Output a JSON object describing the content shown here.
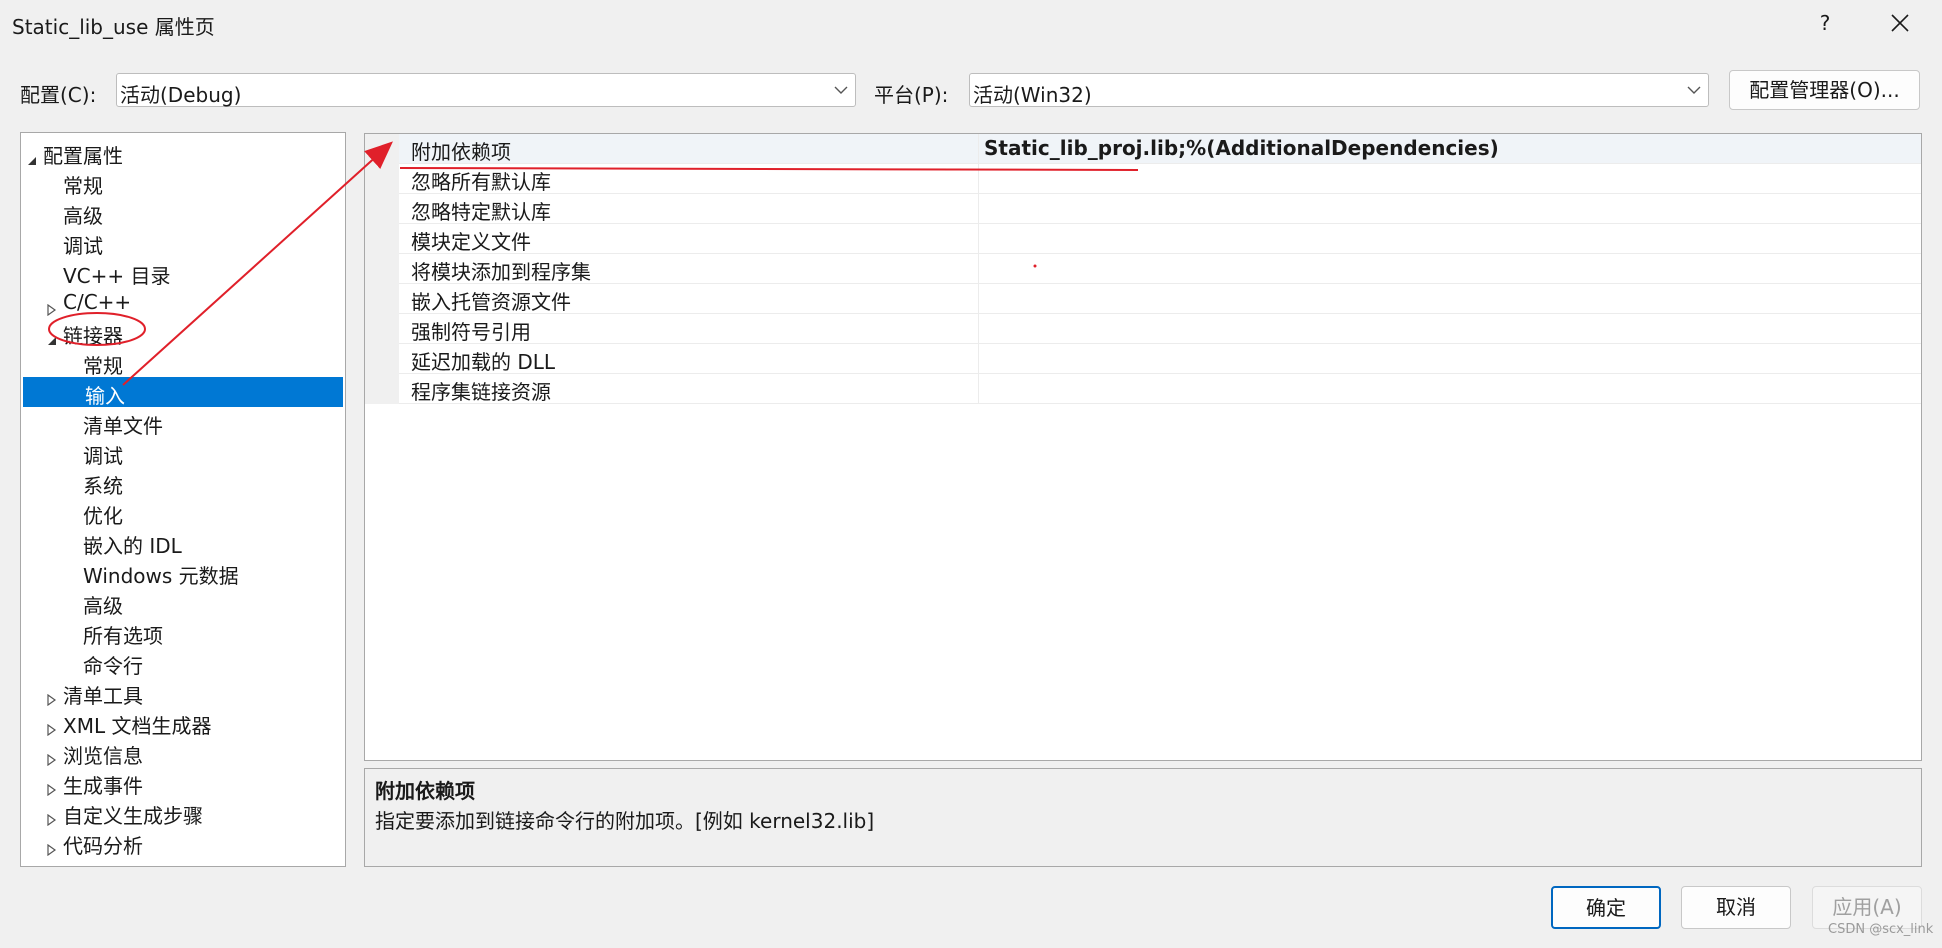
{
  "window": {
    "title": "Static_lib_use 属性页",
    "help_label": "?"
  },
  "config": {
    "config_label": "配置(C):",
    "config_value": "活动(Debug)",
    "platform_label": "平台(P):",
    "platform_value": "活动(Win32)",
    "manager_button": "配置管理器(O)..."
  },
  "tree": {
    "items": [
      {
        "label": "配置属性",
        "level": 0,
        "expander": "expanded"
      },
      {
        "label": "常规",
        "level": 1,
        "expander": "none"
      },
      {
        "label": "高级",
        "level": 1,
        "expander": "none"
      },
      {
        "label": "调试",
        "level": 1,
        "expander": "none"
      },
      {
        "label": "VC++ 目录",
        "level": 1,
        "expander": "none"
      },
      {
        "label": "C/C++",
        "level": 1,
        "expander": "collapsed"
      },
      {
        "label": "链接器",
        "level": 1,
        "expander": "expanded"
      },
      {
        "label": "常规",
        "level": 2,
        "expander": "none"
      },
      {
        "label": "输入",
        "level": 2,
        "expander": "none",
        "selected": true
      },
      {
        "label": "清单文件",
        "level": 2,
        "expander": "none"
      },
      {
        "label": "调试",
        "level": 2,
        "expander": "none"
      },
      {
        "label": "系统",
        "level": 2,
        "expander": "none"
      },
      {
        "label": "优化",
        "level": 2,
        "expander": "none"
      },
      {
        "label": "嵌入的 IDL",
        "level": 2,
        "expander": "none"
      },
      {
        "label": "Windows 元数据",
        "level": 2,
        "expander": "none"
      },
      {
        "label": "高级",
        "level": 2,
        "expander": "none"
      },
      {
        "label": "所有选项",
        "level": 2,
        "expander": "none"
      },
      {
        "label": "命令行",
        "level": 2,
        "expander": "none"
      },
      {
        "label": "清单工具",
        "level": 1,
        "expander": "collapsed"
      },
      {
        "label": "XML 文档生成器",
        "level": 1,
        "expander": "collapsed"
      },
      {
        "label": "浏览信息",
        "level": 1,
        "expander": "collapsed"
      },
      {
        "label": "生成事件",
        "level": 1,
        "expander": "collapsed"
      },
      {
        "label": "自定义生成步骤",
        "level": 1,
        "expander": "collapsed"
      },
      {
        "label": "代码分析",
        "level": 1,
        "expander": "collapsed"
      }
    ]
  },
  "properties": {
    "rows": [
      {
        "name": "附加依赖项",
        "value": "Static_lib_proj.lib;%(AdditionalDependencies)"
      },
      {
        "name": "忽略所有默认库",
        "value": ""
      },
      {
        "name": "忽略特定默认库",
        "value": ""
      },
      {
        "name": "模块定义文件",
        "value": ""
      },
      {
        "name": "将模块添加到程序集",
        "value": ""
      },
      {
        "name": "嵌入托管资源文件",
        "value": ""
      },
      {
        "name": "强制符号引用",
        "value": ""
      },
      {
        "name": "延迟加载的 DLL",
        "value": ""
      },
      {
        "name": "程序集链接资源",
        "value": ""
      }
    ]
  },
  "description": {
    "title": "附加依赖项",
    "text": "指定要添加到链接命令行的附加项。[例如 kernel32.lib]"
  },
  "buttons": {
    "ok": "确定",
    "cancel": "取消",
    "apply": "应用(A)"
  },
  "watermark": "CSDN @scx_link",
  "colors": {
    "selection": "#0078d4",
    "annotation": "#e0202a",
    "background": "#f0f0f0"
  }
}
